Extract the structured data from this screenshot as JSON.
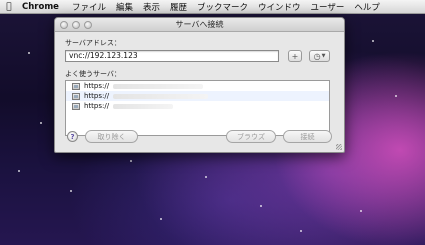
{
  "menubar": {
    "app": "Chrome",
    "items": [
      "ファイル",
      "編集",
      "表示",
      "履歴",
      "ブックマーク",
      "ウインドウ",
      "ユーザー",
      "ヘルプ"
    ]
  },
  "dialog": {
    "title": "サーバへ接続",
    "address_label": "サーバアドレス：",
    "address_value": "vnc://192.123.123",
    "add_button": "+",
    "recent_label": "よく使うサーバ：",
    "favorites": [
      "https://",
      "https://",
      "https://"
    ],
    "help": "?",
    "remove_button": "取り除く",
    "browse_button": "ブラウズ",
    "connect_button": "接続"
  }
}
